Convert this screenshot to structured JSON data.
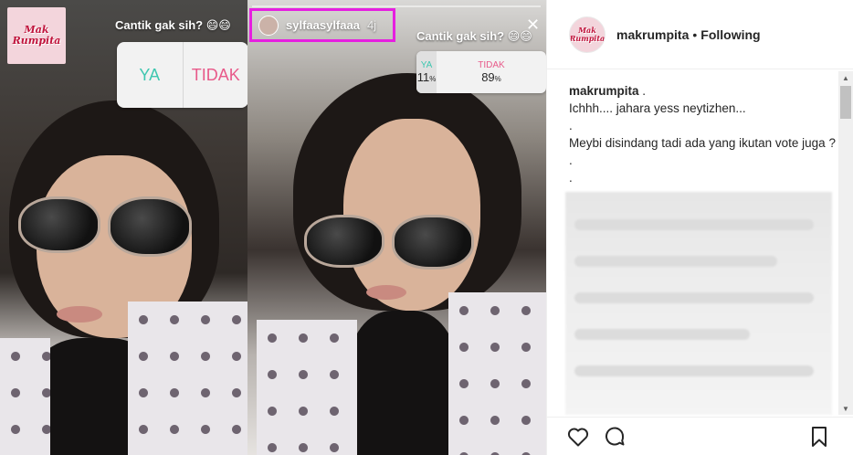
{
  "story_left": {
    "logo_lines": [
      "Mak",
      "Rumpita"
    ],
    "poll_question": "Cantik gak sih? 😄😄",
    "poll_options": [
      "YA",
      "TIDAK"
    ]
  },
  "story_right": {
    "username": "sylfaasylfaaa",
    "time": "4j",
    "poll_question": "Cantik gak sih? 😄😄",
    "results": [
      {
        "label": "YA",
        "percent": "11",
        "unit": "%"
      },
      {
        "label": "TIDAK",
        "percent": "89",
        "unit": "%"
      }
    ],
    "close_symbol": "✕",
    "highlight_color": "#e61fe0"
  },
  "post": {
    "username": "makrumpita",
    "separator": "•",
    "follow_status": "Following",
    "caption_user": "makrumpita",
    "caption_lines": [
      ".",
      "Ichhh.... jahara yess neytizhen...",
      ".",
      "Meybi disindang tadi ada yang ikutan vote juga ?",
      ".",
      "."
    ]
  },
  "actions": {
    "like": "heart-icon",
    "comment": "comment-icon",
    "save": "bookmark-icon"
  },
  "scrollbar": {
    "up": "▲",
    "down": "▼"
  }
}
